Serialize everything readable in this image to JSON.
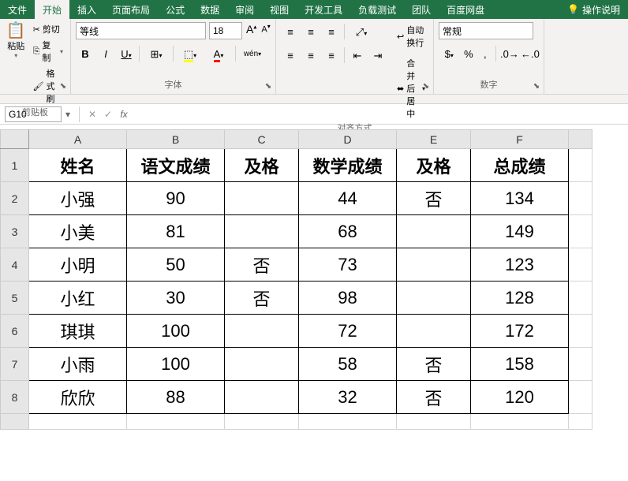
{
  "tabs": {
    "file": "文件",
    "home": "开始",
    "insert": "插入",
    "pageLayout": "页面布局",
    "formulas": "公式",
    "data": "数据",
    "review": "审阅",
    "view": "视图",
    "developer": "开发工具",
    "loadTest": "负载测试",
    "team": "团队",
    "baidu": "百度网盘",
    "help": "操作说明"
  },
  "ribbon": {
    "clipboard": {
      "label": "剪贴板",
      "paste": "粘贴",
      "cut": "剪切",
      "copy": "复制",
      "formatPainter": "格式刷"
    },
    "font": {
      "label": "字体",
      "name": "等线",
      "size": "18",
      "increaseA": "A",
      "decreaseA": "A",
      "bold": "B",
      "italic": "I",
      "underline": "U",
      "wen": "wén"
    },
    "alignment": {
      "label": "对齐方式",
      "wrapText": "自动换行",
      "mergeCenter": "合并后居中"
    },
    "number": {
      "label": "数字",
      "format": "常规"
    }
  },
  "formulaBar": {
    "nameBox": "G10",
    "cancel": "✕",
    "enter": "✓",
    "fx": "fx",
    "value": ""
  },
  "sheet": {
    "columns": [
      "A",
      "B",
      "C",
      "D",
      "E",
      "F"
    ],
    "rows": [
      "1",
      "2",
      "3",
      "4",
      "5",
      "6",
      "7",
      "8"
    ],
    "headers": [
      "姓名",
      "语文成绩",
      "及格",
      "数学成绩",
      "及格",
      "总成绩"
    ],
    "data": [
      [
        "小强",
        "90",
        "",
        "44",
        "否",
        "134"
      ],
      [
        "小美",
        "81",
        "",
        "68",
        "",
        "149"
      ],
      [
        "小明",
        "50",
        "否",
        "73",
        "",
        "123"
      ],
      [
        "小红",
        "30",
        "否",
        "98",
        "",
        "128"
      ],
      [
        "琪琪",
        "100",
        "",
        "72",
        "",
        "172"
      ],
      [
        "小雨",
        "100",
        "",
        "58",
        "否",
        "158"
      ],
      [
        "欣欣",
        "88",
        "",
        "32",
        "否",
        "120"
      ]
    ]
  }
}
